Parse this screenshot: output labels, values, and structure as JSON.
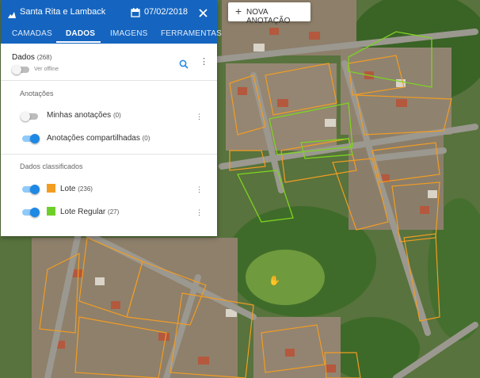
{
  "header": {
    "title": "Santa Rita e Lamback",
    "date": "07/02/2018",
    "bg_color": "#1565c0"
  },
  "tabs": [
    {
      "label": "CAMADAS",
      "active": false
    },
    {
      "label": "DADOS",
      "active": true
    },
    {
      "label": "IMAGENS",
      "active": false
    },
    {
      "label": "FERRAMENTAS",
      "active": false
    }
  ],
  "dados": {
    "label": "Dados",
    "count": "(268)",
    "offline_label": "Ver offline"
  },
  "anotacoes": {
    "section_label": "Anotações",
    "minhas": {
      "label": "Minhas anotações",
      "count": "(0)",
      "enabled": false
    },
    "compartilhadas": {
      "label": "Anotações compartilhadas",
      "count": "(0)",
      "enabled": true
    }
  },
  "classificados": {
    "section_label": "Dados classificados",
    "lote": {
      "label": "Lote",
      "count": "(236)",
      "color": "#f39c22",
      "enabled": true
    },
    "lote_regular": {
      "label": "Lote Regular",
      "count": "(27)",
      "color": "#6fcf2a",
      "enabled": true
    }
  },
  "toolbar": {
    "add_label": "NOVA ANOTAÇÃO",
    "add_icon": "plus-icon"
  },
  "map": {
    "lote_outline_color": "#f39c22",
    "regular_outline_color": "#7ed321"
  }
}
